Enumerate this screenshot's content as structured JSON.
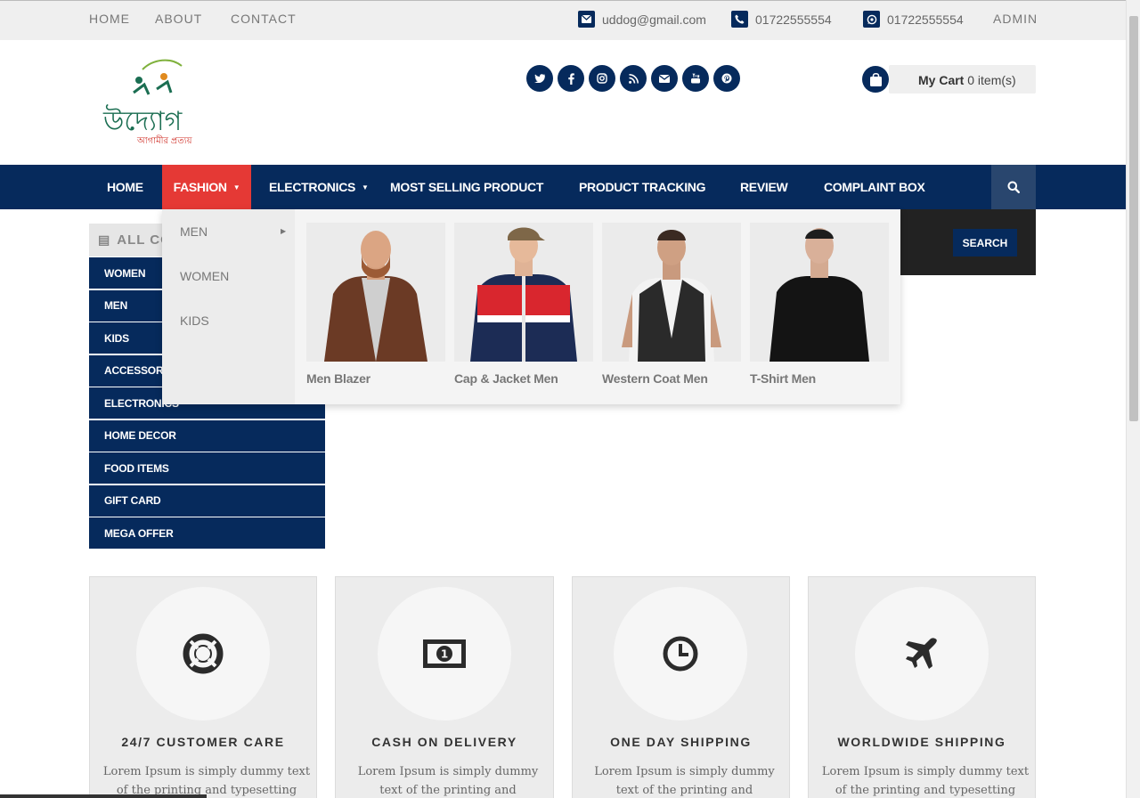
{
  "topbar": {
    "links": [
      "HOME",
      "ABOUT",
      "CONTACT"
    ],
    "email": "uddog@gmail.com",
    "phone": "01722555554",
    "whatsapp": "01722555554",
    "admin": "ADMIN"
  },
  "logo": {
    "word": "উদ্যোগ",
    "tagline": "আগামীর প্রত্যয়"
  },
  "social_icons": [
    "twitter-icon",
    "facebook-icon",
    "instagram-icon",
    "rss-icon",
    "envelope-icon",
    "youtube-icon",
    "pinterest-icon"
  ],
  "cart": {
    "label": "My Cart",
    "count_text": "0 item(s)"
  },
  "mainnav": {
    "items": [
      {
        "label": "HOME"
      },
      {
        "label": "FASHION"
      },
      {
        "label": "ELECTRONICS"
      },
      {
        "label": "MOST SELLING PRODUCT"
      },
      {
        "label": "PRODUCT TRACKING"
      },
      {
        "label": "REVIEW"
      },
      {
        "label": "COMPLAINT BOX"
      }
    ],
    "active": "FASHION"
  },
  "categories": {
    "heading": "ALL CO",
    "items": [
      "WOMEN",
      "MEN",
      "KIDS",
      "ACCESSORIES",
      "ELECTRONICS",
      "HOME DECOR",
      "FOOD ITEMS",
      "GIFT CARD",
      "MEGA OFFER"
    ]
  },
  "search": {
    "button": "SEARCH"
  },
  "mega_menu": {
    "submenu": [
      "MEN",
      "WOMEN",
      "KIDS"
    ],
    "products": [
      {
        "name": "Men Blazer"
      },
      {
        "name": "Cap & Jacket Men"
      },
      {
        "name": "Western Coat Men"
      },
      {
        "name": "T-Shirt Men"
      }
    ]
  },
  "features": [
    {
      "title": "24/7 CUSTOMER CARE",
      "text": "Lorem Ipsum is simply dummy text of the printing and typesetting industry."
    },
    {
      "title": "CASH ON DELIVERY",
      "text": "Lorem Ipsum is simply dummy text of the printing and typesetting industry."
    },
    {
      "title": "ONE DAY SHIPPING",
      "text": "Lorem Ipsum is simply dummy text of the printing and typesetting industry."
    },
    {
      "title": "WORLDWIDE SHIPPING",
      "text": "Lorem Ipsum is simply dummy text of the printing and typesetting industry."
    }
  ],
  "colors": {
    "brand_navy": "#062a5c",
    "active_red": "#e53935"
  }
}
